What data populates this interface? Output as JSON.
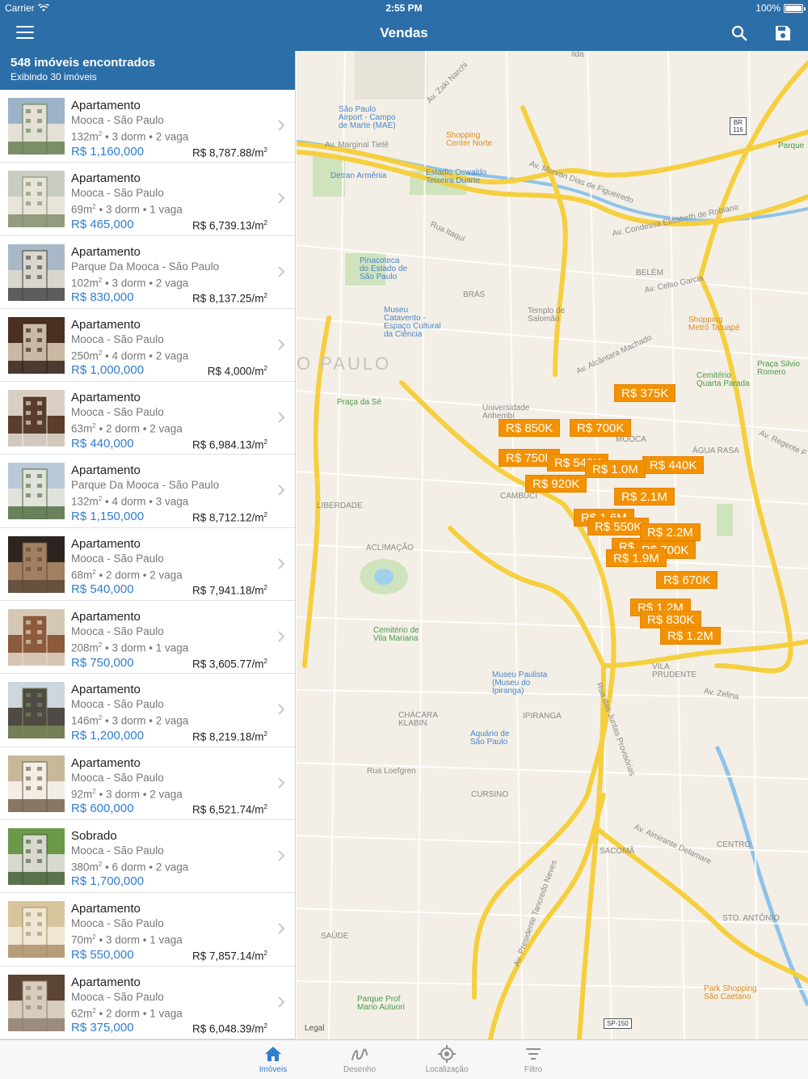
{
  "status_bar": {
    "carrier": "Carrier",
    "time": "2:55 PM",
    "battery": "100%"
  },
  "nav": {
    "title": "Vendas",
    "menu_icon": "hamburger-menu-icon",
    "search_icon": "search-icon",
    "save_icon": "floppy-disk-icon"
  },
  "list": {
    "count_label": "548 imóveis encontrados",
    "showing_label": "Exibindo 30 imóveis",
    "items": [
      {
        "type": "Apartamento",
        "location": "Mooca - São Paulo",
        "area": "132m",
        "dorm": "3 dorm",
        "vaga": "2 vaga",
        "price": "R$ 1,160,000",
        "price_m2": "R$ 8,787.88/m",
        "thumb_colors": [
          "#9db3c8",
          "#e4e0d6",
          "#5f7a4c"
        ]
      },
      {
        "type": "Apartamento",
        "location": "Mooca - São Paulo",
        "area": "69m",
        "dorm": "3 dorm",
        "vaga": "1 vaga",
        "price": "R$ 465,000",
        "price_m2": "R$ 6,739.13/m",
        "thumb_colors": [
          "#c9ccc2",
          "#e8e4d8",
          "#7d8a68"
        ]
      },
      {
        "type": "Apartamento",
        "location": "Parque Da Mooca - São Paulo",
        "area": "102m",
        "dorm": "3 dorm",
        "vaga": "2 vaga",
        "price": "R$ 830,000",
        "price_m2": "R$ 8,137.25/m",
        "thumb_colors": [
          "#a8b8c6",
          "#d9d6ce",
          "#3f3f3f"
        ]
      },
      {
        "type": "Apartamento",
        "location": "Mooca - São Paulo",
        "area": "250m",
        "dorm": "4 dorm",
        "vaga": "2 vaga",
        "price": "R$ 1,000,000",
        "price_m2": "R$ 4,000/m",
        "thumb_colors": [
          "#4a2f22",
          "#c9b8a4",
          "#2a1a12"
        ]
      },
      {
        "type": "Apartamento",
        "location": "Mooca - São Paulo",
        "area": "63m",
        "dorm": "2 dorm",
        "vaga": "2 vaga",
        "price": "R$ 440,000",
        "price_m2": "R$ 6,984.13/m",
        "thumb_colors": [
          "#d8cfc2",
          "#5a3e2b",
          "#f0ece4"
        ]
      },
      {
        "type": "Apartamento",
        "location": "Parque Da Mooca - São Paulo",
        "area": "132m",
        "dorm": "4 dorm",
        "vaga": "3 vaga",
        "price": "R$ 1,150,000",
        "price_m2": "R$ 8,712.12/m",
        "thumb_colors": [
          "#b9c9d8",
          "#e2e2dc",
          "#4c6a3c"
        ]
      },
      {
        "type": "Apartamento",
        "location": "Mooca - São Paulo",
        "area": "68m",
        "dorm": "2 dorm",
        "vaga": "2 vaga",
        "price": "R$ 540,000",
        "price_m2": "R$ 7,941.18/m",
        "thumb_colors": [
          "#2c2420",
          "#a08060",
          "#5a4636"
        ]
      },
      {
        "type": "Apartamento",
        "location": "Mooca - São Paulo",
        "area": "208m",
        "dorm": "3 dorm",
        "vaga": "1 vaga",
        "price": "R$ 750,000",
        "price_m2": "R$ 3,605.77/m",
        "thumb_colors": [
          "#d4c8b4",
          "#8c5a3c",
          "#e8e0d0"
        ]
      },
      {
        "type": "Apartamento",
        "location": "Mooca - São Paulo",
        "area": "146m",
        "dorm": "3 dorm",
        "vaga": "2 vaga",
        "price": "R$ 1,200,000",
        "price_m2": "R$ 8,219.18/m",
        "thumb_colors": [
          "#cdd6dc",
          "#4f4a44",
          "#7c8c5c"
        ]
      },
      {
        "type": "Apartamento",
        "location": "Mooca - São Paulo",
        "area": "92m",
        "dorm": "3 dorm",
        "vaga": "2 vaga",
        "price": "R$ 600,000",
        "price_m2": "R$ 6,521.74/m",
        "thumb_colors": [
          "#c8b89a",
          "#f2eee6",
          "#6c5a44"
        ]
      },
      {
        "type": "Sobrado",
        "location": "Mooca - São Paulo",
        "area": "380m",
        "dorm": "6 dorm",
        "vaga": "2 vaga",
        "price": "R$ 1,700,000",
        "price_m2": "",
        "thumb_colors": [
          "#6a9a48",
          "#d8d8d0",
          "#3c5a2c"
        ]
      },
      {
        "type": "Apartamento",
        "location": "Mooca - São Paulo",
        "area": "70m",
        "dorm": "3 dorm",
        "vaga": "1 vaga",
        "price": "R$ 550,000",
        "price_m2": "R$ 7,857.14/m",
        "thumb_colors": [
          "#d8c49c",
          "#efe6d4",
          "#a88c64"
        ]
      },
      {
        "type": "Apartamento",
        "location": "Mooca - São Paulo",
        "area": "62m",
        "dorm": "2 dorm",
        "vaga": "1 vaga",
        "price": "R$ 375,000",
        "price_m2": "R$ 6,048.39/m",
        "thumb_colors": [
          "#5c4434",
          "#d8ccbc",
          "#8c7c6c"
        ]
      }
    ]
  },
  "map": {
    "labels": {
      "vila_guilherme_top": "ilda",
      "zaki": "Av. Zaki Narchi",
      "airport": "São Paulo\nAirport - Campo\nde Marte (MAE)",
      "shopping_norte": "Shopping\nCenter Norte",
      "marginal": "Av. Marginal Tietê",
      "detran": "Detran Armênia",
      "estadio": "Estadio Oswaldo\nTeixeira Duarte",
      "morvan": "Av. Morvan Dias de Figueiredo",
      "condessa": "Av. Condessa Elisabeth de Robiano",
      "itaqui": "Rua Itaqui",
      "pinacoteca": "Pinacoteca\ndo Estado de\nSão Paulo",
      "bras": "BRÁS",
      "belem": "BELÉM",
      "celso": "Av. Celso Garcia",
      "templo": "Templo de\nSalomão",
      "museu_catavento": "Museu\nCatavento -\nEspaço Cultural\nda Ciência",
      "sao_paulo_big": "O PAULO",
      "praca_se": "Praça da Sé",
      "alcantara": "Av. Alcântara Machado",
      "shopping_tatuape": "Shopping\nMetrô Tatuapé",
      "praca_silvio": "Praça Silvio\nRomero",
      "cemiterio_quarta": "Cemitério\nQuarta Parada",
      "anhembi": "Universidade\nAnhembi",
      "mooca": "MOOCA",
      "agua_rasa": "ÁGUA RASA",
      "regente": "Av. Regente F",
      "liberdade": "LIBERDADE",
      "cambuci": "CAMBUCI",
      "aclimacao": "ACLIMAÇÃO",
      "cemiterio_vila": "Cemitério de\nVila Mariana",
      "vila_prudente": "VILA\nPRUDENTE",
      "zelina": "Av. Zelina",
      "museu_paulista": "Museu Paulista\n(Museu do\nIpiranga)",
      "ipiranga": "IPIRANGA",
      "chacara": "CHÁCARA\nKLABIN",
      "aquario": "Aquário de\nSão Paulo",
      "loefgren": "Rua Loefgren",
      "cursino": "CURSINO",
      "sacoma": "SACOMÃ",
      "almirante": "Av. Almirante Delamare",
      "centro": "CENTRO",
      "sto_antonio": "STO. ANTÔNIO",
      "saude": "SAÚDE",
      "parque_autuori": "Parque Prof\nMario Autuori",
      "park_shopping": "Park Shopping\nSão Caetano",
      "br116": "BR\n116",
      "sp150": "SP-150",
      "legal": "Legal",
      "juntas": "Rua das Juntas Provisórias",
      "tancredo": "Av. Presidente Tancredo Neves",
      "parque_top": "Parque"
    },
    "pins": [
      "R$ 375K",
      "R$ 850K",
      "R$ 700K",
      "R$ 750K",
      "R$ 540K",
      "R$ 440K",
      "R$ 1.0M",
      "R$ 920K",
      "R$ 2.1M",
      "R$ 1.6M",
      "R$ 550K",
      "R$ 2.2M",
      "R$",
      "R$ 700K",
      "R$ 1.9M",
      "R$ 670K",
      "R$ 1.2M",
      "R$ 830K",
      "R$ 1.2M"
    ]
  },
  "tabs": [
    {
      "label": "Imóveis",
      "icon": "home-icon",
      "active": true
    },
    {
      "label": "Desenho",
      "icon": "draw-squiggle-icon",
      "active": false
    },
    {
      "label": "Localização",
      "icon": "location-target-icon",
      "active": false
    },
    {
      "label": "Filtro",
      "icon": "filter-icon",
      "active": false
    }
  ],
  "colors": {
    "brand": "#2c6ea7",
    "price": "#2f7dd1",
    "pin": "#f29203"
  }
}
